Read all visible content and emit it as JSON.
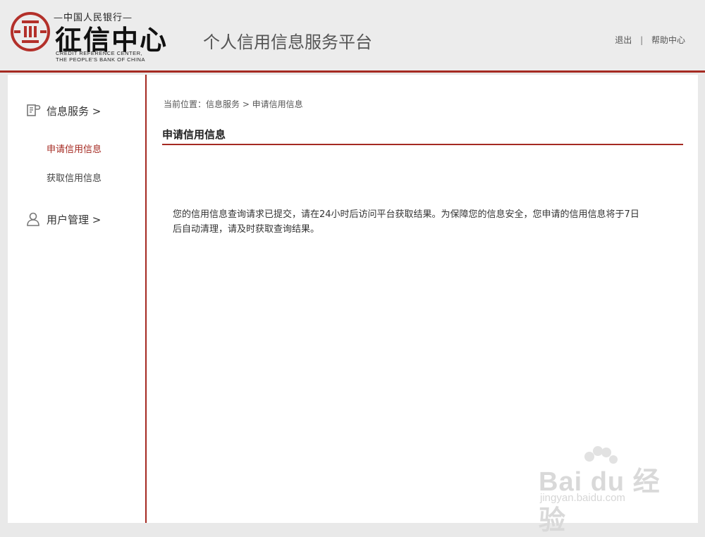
{
  "logo": {
    "top_text": "—中国人民银行—",
    "main_text": "征信中心",
    "english_line1": "CREDIT REFERENCE CENTER,",
    "english_line2": "THE PEOPLE'S BANK OF CHINA"
  },
  "header": {
    "platform_title": "个人信用信息服务平台",
    "links": {
      "logout": "退出",
      "separator": "|",
      "help": "帮助中心"
    }
  },
  "sidebar": {
    "groups": [
      {
        "label": "信息服务 >",
        "icon": "document-icon",
        "items": [
          {
            "label": "申请信用信息",
            "active": true
          },
          {
            "label": "获取信用信息",
            "active": false
          }
        ]
      },
      {
        "label": "用户管理 >",
        "icon": "user-icon",
        "items": []
      }
    ]
  },
  "main": {
    "breadcrumb": "当前位置：信息服务 > 申请信用信息",
    "section_title": "申请信用信息",
    "message_line1": "您的信用信息查询请求已提交，请在24小时后访问平台获取结果。为保障您的信息安全，您申请的信用信息将于7日",
    "message_line2": "后自动清理，请及时获取查询结果。"
  },
  "watermark": {
    "main": "Bai du 经验",
    "sub": "jingyan.baidu.com"
  },
  "colors": {
    "accent": "#a52a22",
    "header_bg": "#ececec",
    "page_bg": "#e9e9e9"
  }
}
